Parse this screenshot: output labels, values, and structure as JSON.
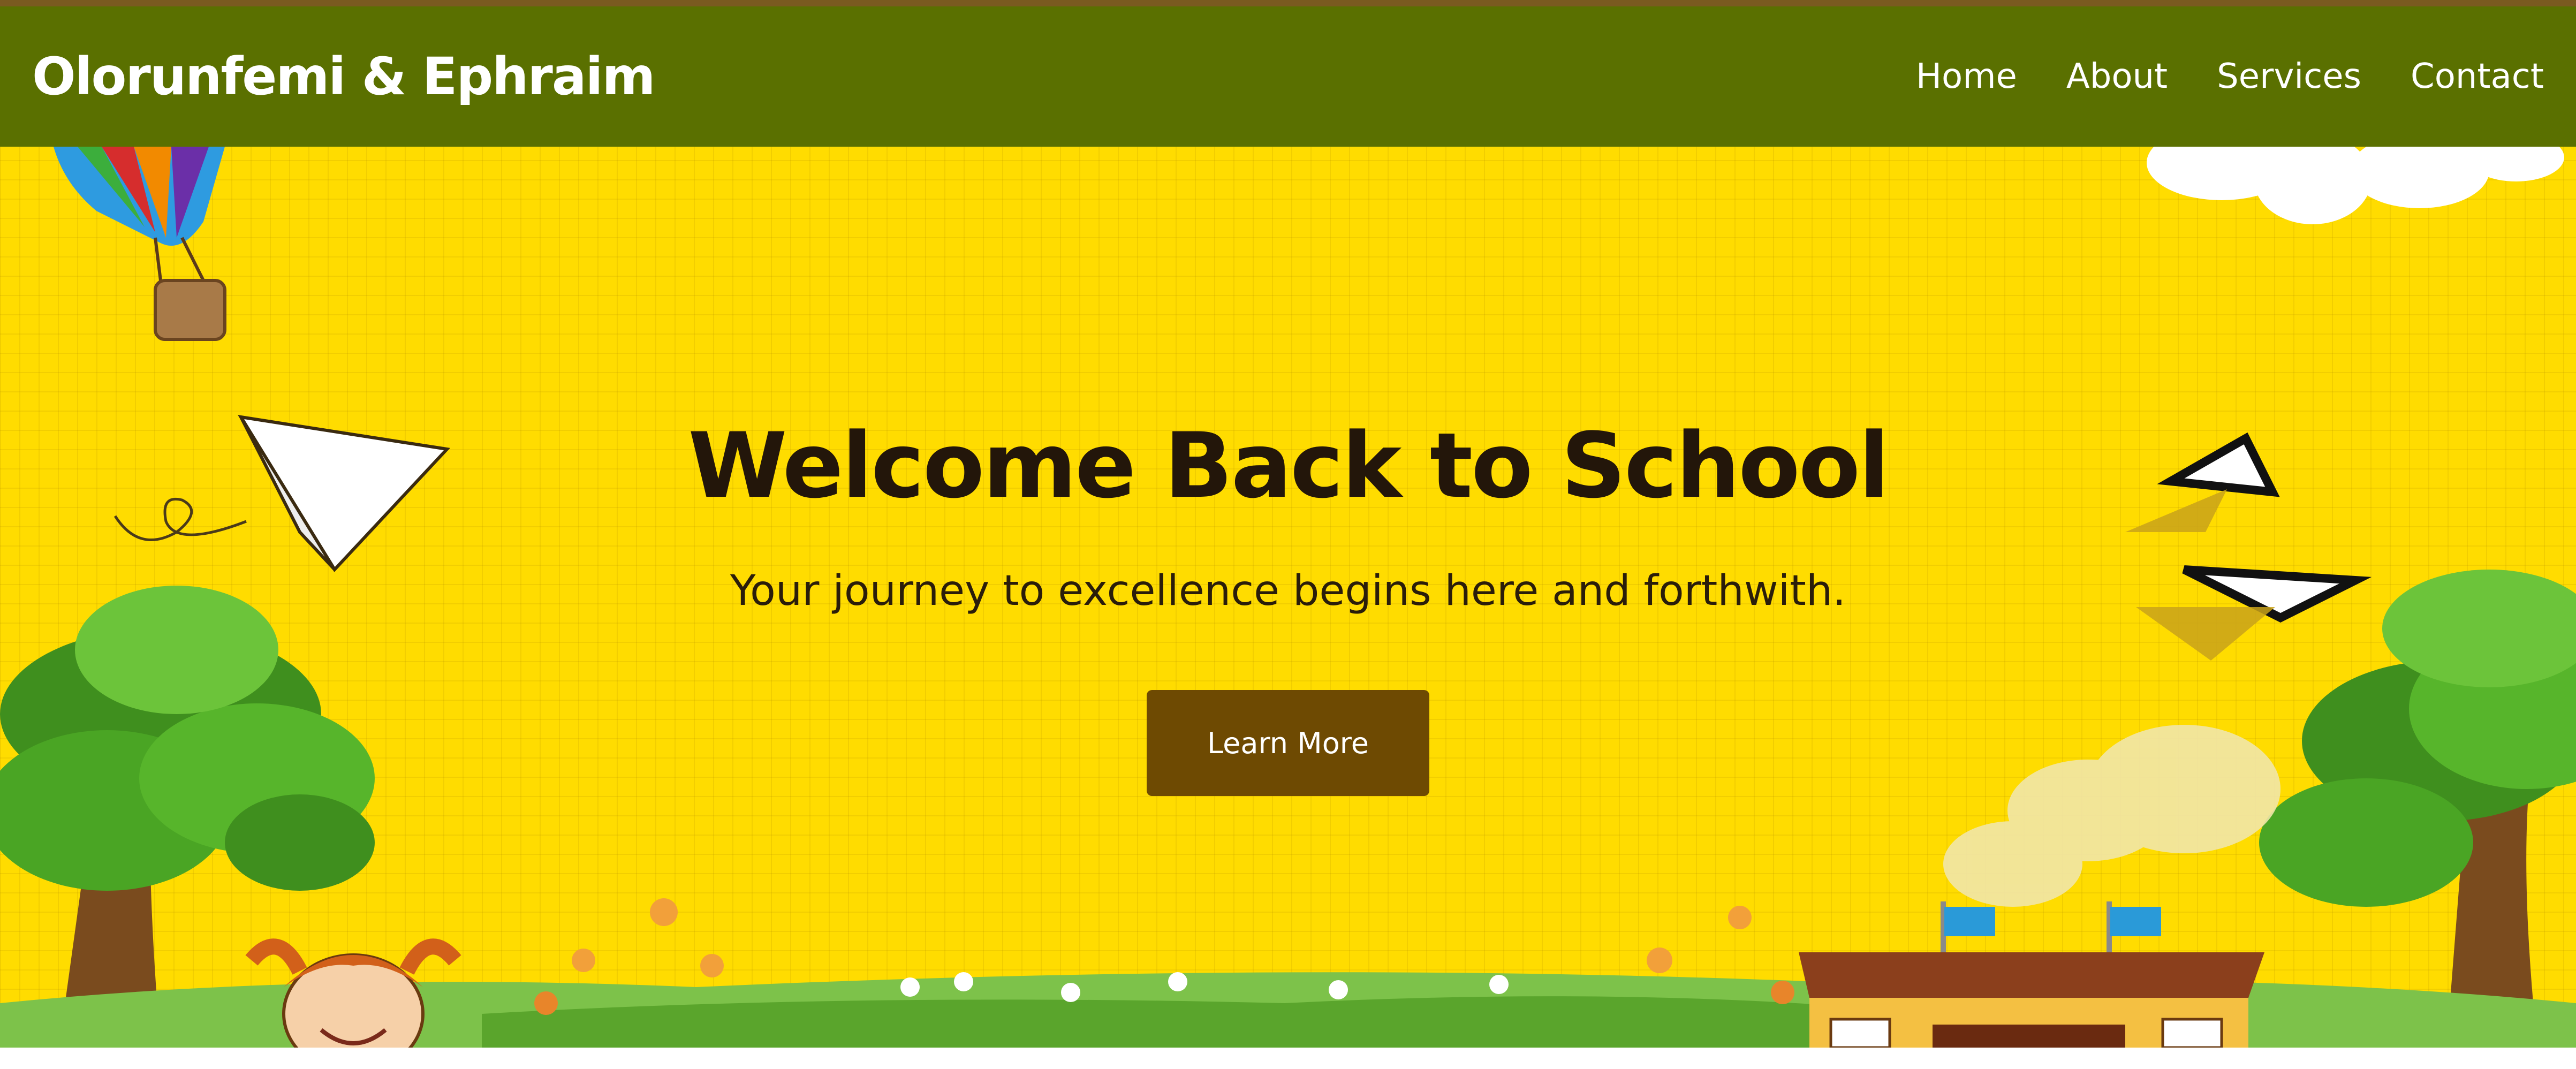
{
  "header": {
    "brand": "Olorunfemi & Ephraim",
    "nav": [
      {
        "label": "Home"
      },
      {
        "label": "About"
      },
      {
        "label": "Services"
      },
      {
        "label": "Contact"
      }
    ]
  },
  "hero": {
    "title": "Welcome Back to School",
    "subtitle": "Your journey to excellence begins here and forthwith.",
    "button_label": "Learn More"
  },
  "colors": {
    "nav_bg": "#5a7000",
    "hero_bg": "#ffdc00",
    "button_bg": "#6e4a02",
    "title_text": "#23160a"
  },
  "decorations": [
    "hot-air-balloon-icon",
    "paper-plane-icon",
    "paper-plane-small-icon",
    "cloud-icon",
    "tree-icon",
    "school-building-icon",
    "flower-meadow",
    "cartoon-girl"
  ]
}
